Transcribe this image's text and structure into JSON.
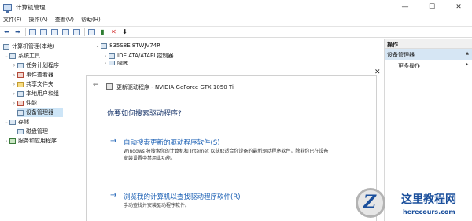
{
  "window": {
    "title": "计算机管理",
    "minimize": "—",
    "maximize": "☐",
    "close": "✕"
  },
  "menu": [
    "文件(F)",
    "操作(A)",
    "查看(V)",
    "帮助(H)"
  ],
  "tree": {
    "root": "计算机管理(本地)",
    "system_tools": "系统工具",
    "task_scheduler": "任务计划程序",
    "event_viewer": "事件查看器",
    "shared_folders": "共享文件夹",
    "local_users": "本地用户和组",
    "performance": "性能",
    "device_manager": "设备管理器",
    "storage": "存储",
    "disk_management": "磁盘管理",
    "services_apps": "服务和应用程序"
  },
  "devices": {
    "computer": "835S8EI8TWJV74R",
    "ide": "IDE ATA/ATAPI 控制器",
    "partial": "隐藏"
  },
  "actions": {
    "header": "操作",
    "section": "设备管理器",
    "more": "更多操作"
  },
  "dialog": {
    "title": "更新驱动程序 - NVIDIA GeForce GTX 1050 Ti",
    "question": "你要如何搜索驱动程序?",
    "option1_title": "自动搜索更新的驱动程序软件(S)",
    "option1_desc": "Windows 将搜索你的计算机和 Internet 以获取适合你设备的最新驱动程序软件，除非你已在设备安装设置中禁用此功能。",
    "option2_title": "浏览我的计算机以查找驱动程序软件(R)",
    "option2_desc": "手动查找并安装驱动程序软件。",
    "close": "✕",
    "back": "←"
  },
  "watermark": {
    "logo_letter": "Z",
    "title": "这里教程网",
    "url": "herecours.com"
  }
}
